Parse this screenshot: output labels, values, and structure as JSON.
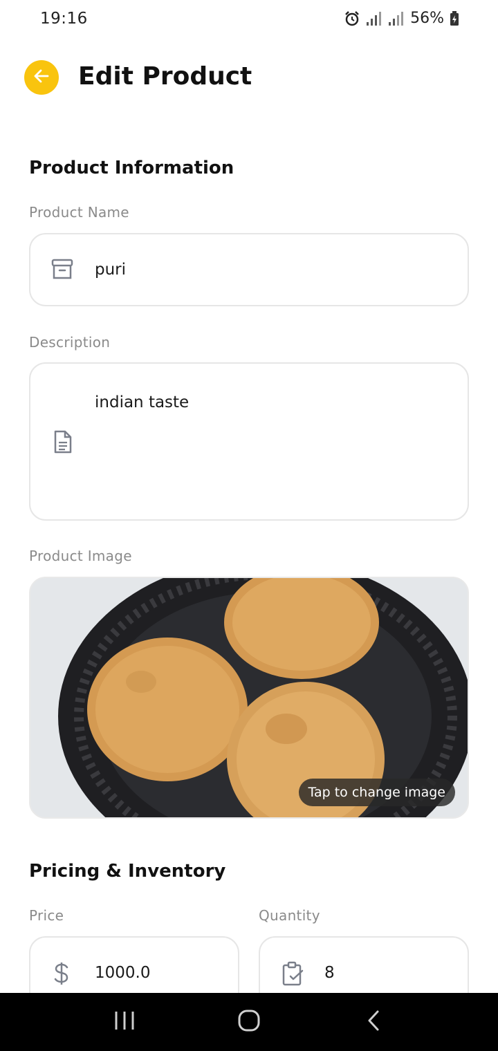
{
  "status": {
    "time": "19:16",
    "battery": "56%"
  },
  "header": {
    "title": "Edit Product"
  },
  "product_info": {
    "section_title": "Product Information",
    "name_label": "Product Name",
    "name_value": "puri",
    "description_label": "Description",
    "description_value": "indian taste",
    "image_label": "Product Image",
    "image_hint": "Tap to change image"
  },
  "pricing": {
    "section_title": "Pricing & Inventory",
    "price_label": "Price",
    "price_value": "1000.0",
    "quantity_label": "Quantity",
    "quantity_value": "8"
  },
  "colors": {
    "accent": "#F9C40E",
    "icon_gray": "#7a7f8a"
  },
  "icons": [
    "alarm-icon",
    "signal-icon",
    "battery-icon",
    "back-arrow-icon",
    "archive-box-icon",
    "document-icon",
    "dollar-icon",
    "clipboard-check-icon",
    "recent-apps-icon",
    "home-icon",
    "nav-back-icon"
  ]
}
